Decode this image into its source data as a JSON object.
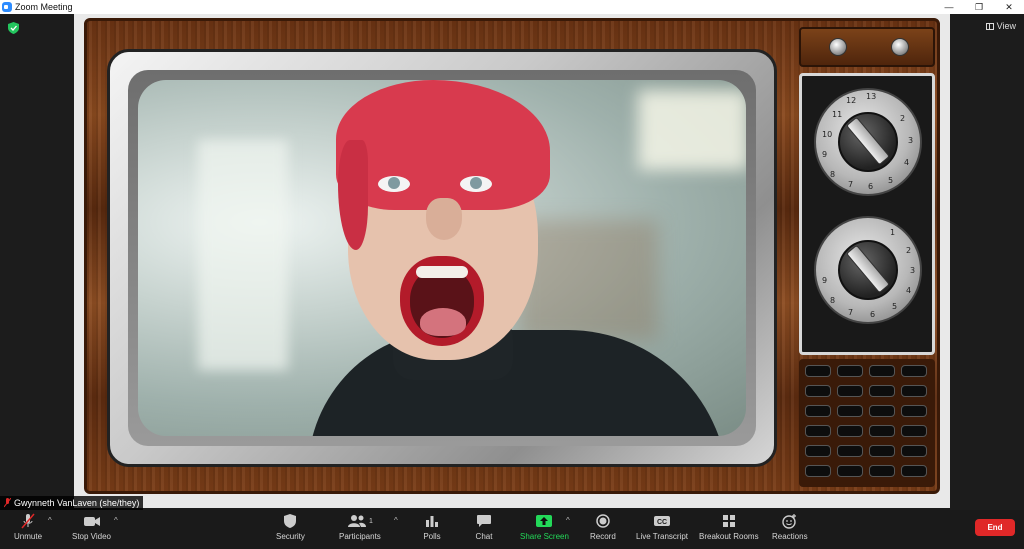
{
  "window": {
    "title": "Zoom Meeting",
    "controls": {
      "minimize": "—",
      "restore": "❐",
      "close": "✕"
    }
  },
  "top_bar": {
    "view_label": "View"
  },
  "participant": {
    "name": "Gwynneth VanLaven (she/they)",
    "muted": true,
    "virtual_background": "retro-tv-frame"
  },
  "dials": {
    "top_numbers": [
      "13",
      "12",
      "11",
      "10",
      "9",
      "8",
      "7",
      "6",
      "5",
      "4",
      "3",
      "2"
    ],
    "bottom_numbers": [
      "1",
      "2",
      "3",
      "4",
      "5",
      "6",
      "7",
      "8",
      "9"
    ]
  },
  "toolbar": {
    "unmute": "Unmute",
    "stop_video": "Stop Video",
    "security": "Security",
    "participants": "Participants",
    "participant_count": "1",
    "polls": "Polls",
    "chat": "Chat",
    "share_screen": "Share Screen",
    "record": "Record",
    "live_transcript": "Live Transcript",
    "cc_badge": "CC",
    "breakout_rooms": "Breakout Rooms",
    "reactions": "Reactions",
    "end": "End"
  },
  "colors": {
    "end_button": "#e02828",
    "share_screen": "#23d959",
    "security_badge": "#23c55e",
    "zoom_blue": "#2d8cff"
  }
}
